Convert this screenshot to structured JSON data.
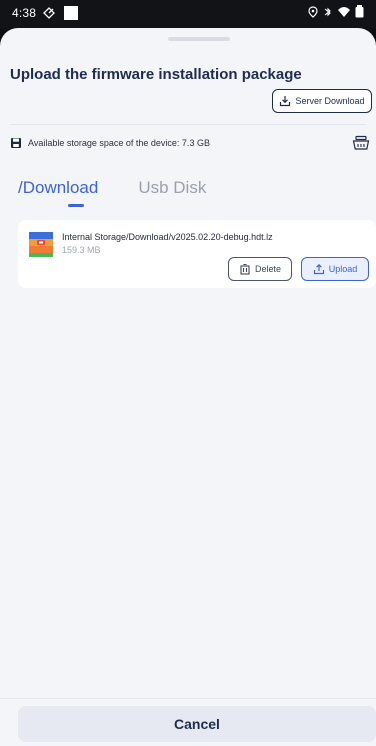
{
  "status_bar": {
    "time": "4:38"
  },
  "sheet": {
    "title": "Upload the firmware installation package",
    "server_download_label": "Server Download",
    "storage_text": "Available storage space of the device: 7.3 GB"
  },
  "tabs": [
    {
      "label": "/Download",
      "active": true
    },
    {
      "label": "Usb Disk",
      "active": false
    }
  ],
  "files": [
    {
      "path": "Internal Storage/Download/v2025.02.20-debug.hdt.lz",
      "size": "159.3 MB",
      "delete_label": "Delete",
      "upload_label": "Upload"
    }
  ],
  "footer": {
    "cancel_label": "Cancel"
  },
  "colors": {
    "accent": "#3d63d6",
    "title": "#1e2d4f",
    "sheet_bg": "#f4f5f9"
  },
  "icons": {
    "save": "save-icon",
    "basket": "basket-icon",
    "archive": "archive-icon",
    "trash": "trash-icon",
    "upload": "upload-icon",
    "download": "download-icon"
  }
}
